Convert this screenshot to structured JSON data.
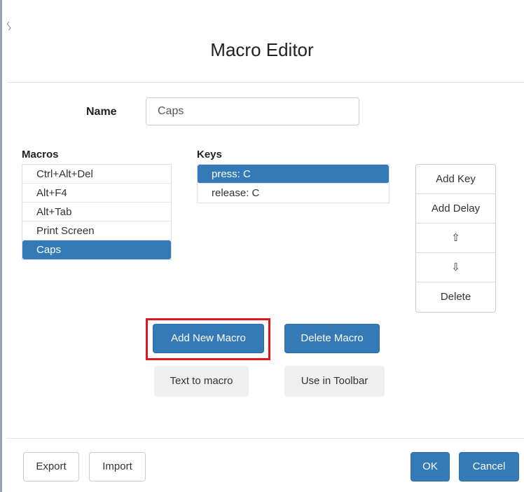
{
  "dialog": {
    "title": "Macro Editor"
  },
  "name_field": {
    "label": "Name",
    "value": "Caps"
  },
  "macros": {
    "label": "Macros",
    "items": [
      "Ctrl+Alt+Del",
      "Alt+F4",
      "Alt+Tab",
      "Print Screen",
      "Caps"
    ],
    "selected": "Caps"
  },
  "keys": {
    "label": "Keys",
    "items": [
      "press: C",
      "release: C"
    ],
    "selected": "press: C"
  },
  "key_actions": {
    "add_key": "Add Key",
    "add_delay": "Add Delay",
    "move_up": "⇧",
    "move_down": "⇩",
    "delete": "Delete"
  },
  "macro_actions": {
    "add_new_macro": "Add New Macro",
    "delete_macro": "Delete Macro",
    "text_to_macro": "Text to macro",
    "use_in_toolbar": "Use in Toolbar"
  },
  "footer": {
    "export": "Export",
    "import": "Import",
    "ok": "OK",
    "cancel": "Cancel"
  },
  "colors": {
    "primary": "#337ab7",
    "highlight": "#e0161e"
  }
}
